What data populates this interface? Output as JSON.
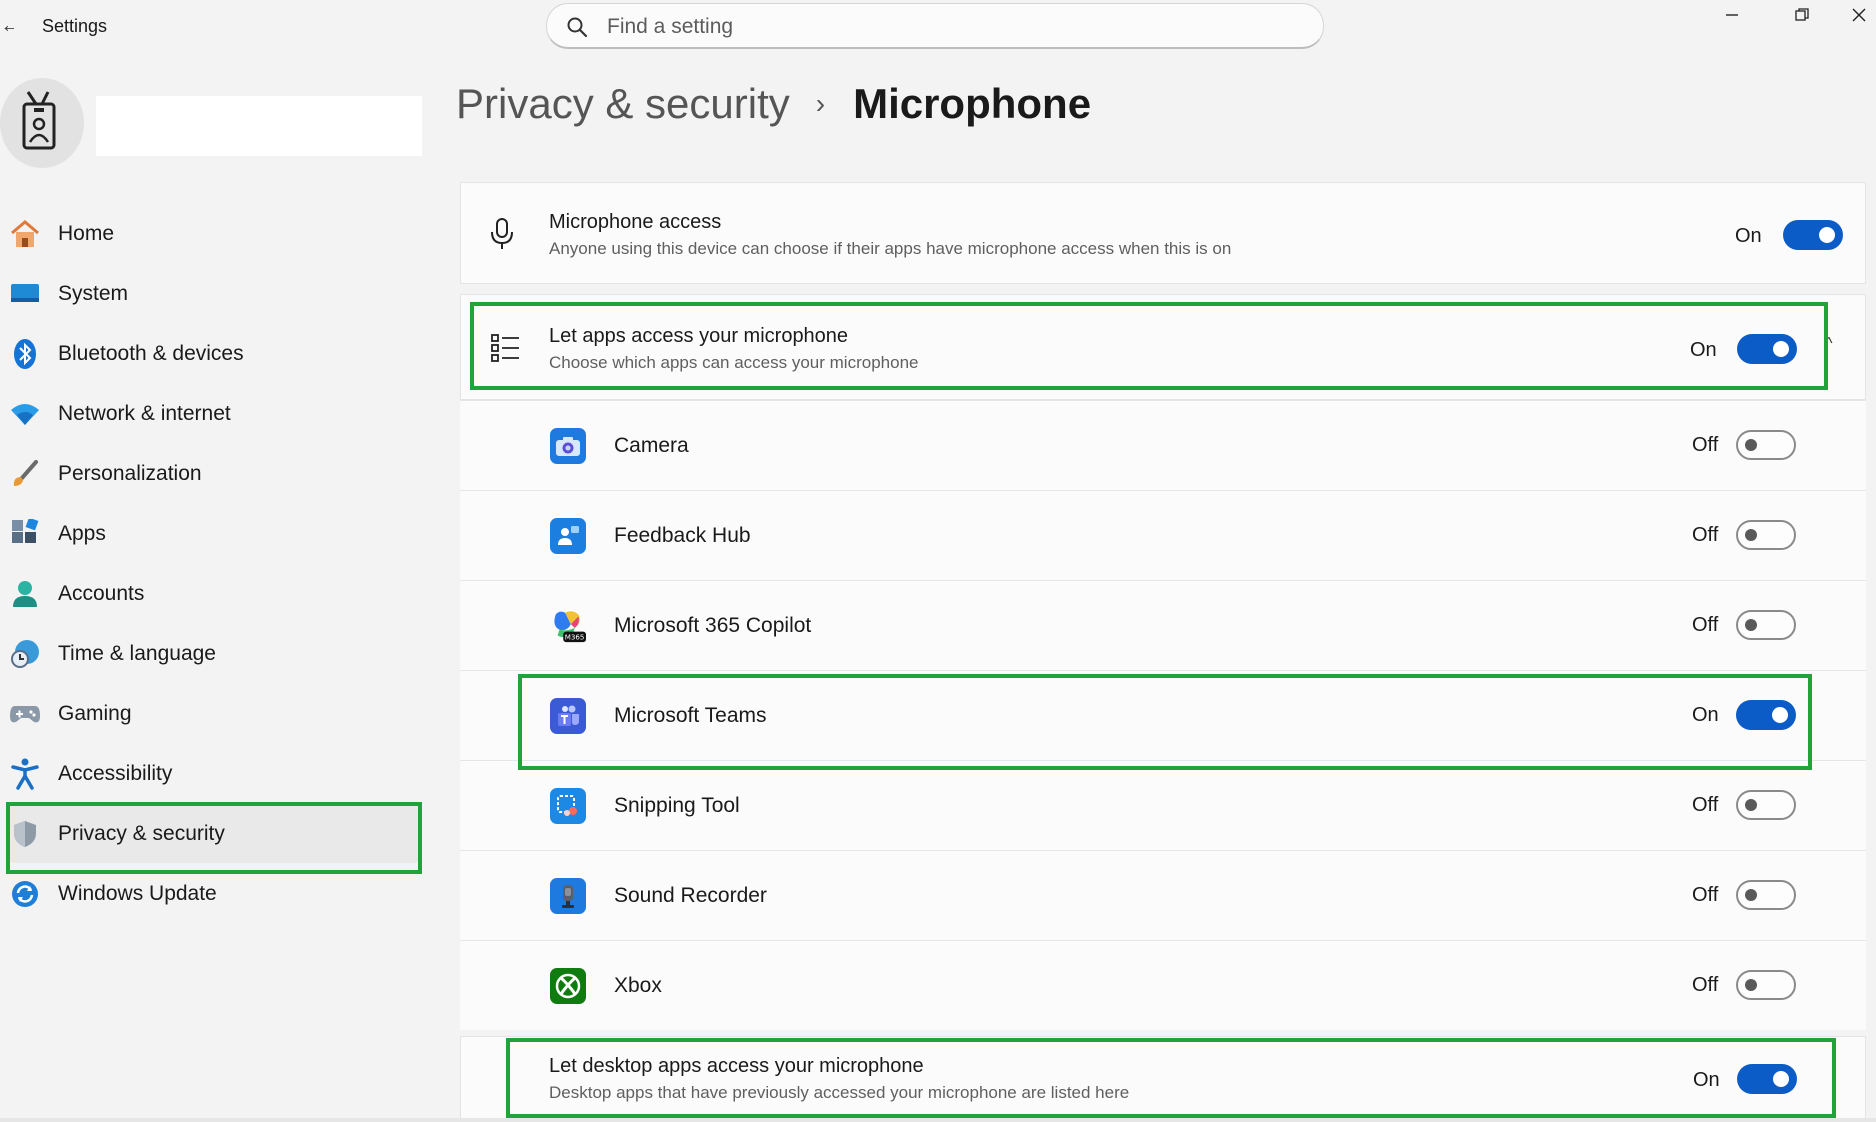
{
  "window": {
    "title": "Settings",
    "search_placeholder": "Find a setting"
  },
  "sidebar": {
    "items": [
      {
        "label": "Home",
        "icon": "home-icon"
      },
      {
        "label": "System",
        "icon": "system-icon"
      },
      {
        "label": "Bluetooth & devices",
        "icon": "bluetooth-icon"
      },
      {
        "label": "Network & internet",
        "icon": "wifi-icon"
      },
      {
        "label": "Personalization",
        "icon": "brush-icon"
      },
      {
        "label": "Apps",
        "icon": "apps-icon"
      },
      {
        "label": "Accounts",
        "icon": "person-icon"
      },
      {
        "label": "Time & language",
        "icon": "globe-clock-icon"
      },
      {
        "label": "Gaming",
        "icon": "gamepad-icon"
      },
      {
        "label": "Accessibility",
        "icon": "accessibility-icon"
      },
      {
        "label": "Privacy & security",
        "icon": "shield-icon",
        "selected": true
      },
      {
        "label": "Windows Update",
        "icon": "update-icon"
      }
    ]
  },
  "header": {
    "parent": "Privacy & security",
    "separator": "›",
    "current": "Microphone"
  },
  "microphone_access": {
    "title": "Microphone access",
    "subtitle": "Anyone using this device can choose if their apps have microphone access when this is on",
    "state": "On"
  },
  "let_apps": {
    "title": "Let apps access your microphone",
    "subtitle": "Choose which apps can access your microphone",
    "state": "On",
    "expand_glyph": "^"
  },
  "apps": [
    {
      "name": "Camera",
      "state": "Off",
      "icon": "camera-app-icon"
    },
    {
      "name": "Feedback Hub",
      "state": "Off",
      "icon": "feedback-hub-icon"
    },
    {
      "name": "Microsoft 365 Copilot",
      "state": "Off",
      "icon": "m365-copilot-icon"
    },
    {
      "name": "Microsoft Teams",
      "state": "On",
      "icon": "teams-icon"
    },
    {
      "name": "Snipping Tool",
      "state": "Off",
      "icon": "snipping-tool-icon"
    },
    {
      "name": "Sound Recorder",
      "state": "Off",
      "icon": "sound-recorder-icon"
    },
    {
      "name": "Xbox",
      "state": "Off",
      "icon": "xbox-icon"
    }
  ],
  "desktop_apps": {
    "title": "Let desktop apps access your microphone",
    "subtitle": "Desktop apps that have previously accessed your microphone are listed here",
    "state": "On"
  },
  "colors": {
    "accent": "#0b5cc6",
    "highlight": "#20a33a",
    "background": "#f3f3f3",
    "card": "#fbfbfb"
  }
}
